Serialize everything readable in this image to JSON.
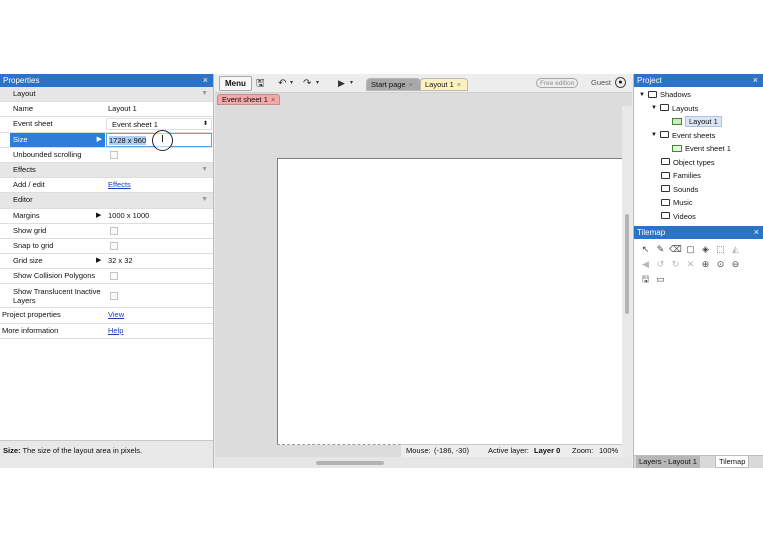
{
  "properties": {
    "title": "Properties",
    "close": "×",
    "rows": {
      "layout_section": "Layout",
      "name_label": "Name",
      "name_value": "Layout 1",
      "eventsheet_label": "Event sheet",
      "eventsheet_value": "Event sheet 1",
      "size_label": "Size",
      "size_value": "1728 x 960",
      "unbounded_label": "Unbounded scrolling",
      "effects_section": "Effects",
      "addedit_label": "Add / edit",
      "addedit_link": "Effects",
      "editor_section": "Editor",
      "margins_label": "Margins",
      "margins_value": "1000 x 1000",
      "showgrid_label": "Show grid",
      "snapgrid_label": "Snap to grid",
      "gridsize_label": "Grid size",
      "gridsize_value": "32 x 32",
      "collision_label": "Show Collision Polygons",
      "translucent_label": "Show Translucent Inactive Layers",
      "projprops_label": "Project properties",
      "projprops_link": "View",
      "moreinfo_label": "More information",
      "moreinfo_link": "Help"
    },
    "help_label": "Size:",
    "help_text": "The size of the layout area in pixels."
  },
  "toolbar": {
    "menu_label": "Menu",
    "tab_startpage": "Start page",
    "tab_layout": "Layout 1",
    "tab_close": "×",
    "free_edition": "Free edition",
    "guest": "Guest",
    "subtab_eventsheet": "Event sheet 1"
  },
  "status": {
    "mouse_label": "Mouse:",
    "mouse_value": "(-186, -30)",
    "layer_label": "Active layer:",
    "layer_value": "Layer 0",
    "zoom_label": "Zoom:",
    "zoom_value": "100%"
  },
  "project": {
    "title": "Project",
    "close": "×",
    "items": {
      "root": "Shadows",
      "layouts": "Layouts",
      "layout1": "Layout 1",
      "eventsheets": "Event sheets",
      "eventsheet1": "Event sheet 1",
      "objecttypes": "Object types",
      "families": "Families",
      "sounds": "Sounds",
      "music": "Music",
      "videos": "Videos"
    }
  },
  "tilemap": {
    "title": "Tilemap",
    "close": "×",
    "tab_layers": "Layers - Layout 1",
    "tab_tilemap": "Tilemap"
  }
}
